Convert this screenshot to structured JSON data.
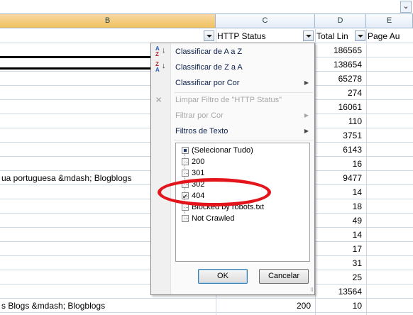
{
  "window": {
    "expand_label": "⌄"
  },
  "columns": {
    "b": "B",
    "c": "C",
    "d": "D",
    "e": "E"
  },
  "headers": {
    "c": "HTTP Status",
    "d": "Total Lin",
    "e": "Page Au"
  },
  "rows": [
    {
      "b": "",
      "c": "",
      "d": "186565"
    },
    {
      "b": "",
      "c": "",
      "d": "138654"
    },
    {
      "b": "",
      "c": "",
      "d": "65278"
    },
    {
      "b": "",
      "c": "",
      "d": "274"
    },
    {
      "b": "",
      "c": "",
      "d": "16061"
    },
    {
      "b": "",
      "c": "",
      "d": "110"
    },
    {
      "b": "",
      "c": "",
      "d": "3751"
    },
    {
      "b": "",
      "c": "",
      "d": "6143"
    },
    {
      "b": "",
      "c": "",
      "d": "16"
    },
    {
      "b": "ua portuguesa &mdash; Blogblogs",
      "c": "",
      "d": "9477"
    },
    {
      "b": "",
      "c": "",
      "d": "14"
    },
    {
      "b": "",
      "c": "",
      "d": "18"
    },
    {
      "b": "",
      "c": "",
      "d": "49"
    },
    {
      "b": "",
      "c": "",
      "d": "14"
    },
    {
      "b": "",
      "c": "",
      "d": "17"
    },
    {
      "b": "",
      "c": "",
      "d": "31"
    },
    {
      "b": "",
      "c": "",
      "d": "25"
    },
    {
      "b": "",
      "c": "",
      "d": "13564"
    },
    {
      "b": "s Blogs &mdash; Blogblogs",
      "c": "200",
      "d": "10"
    }
  ],
  "menu": {
    "sort_az": "Classificar de A a Z",
    "sort_za": "Classificar de Z a A",
    "sort_color": "Classificar por Cor",
    "clear_filter": "Limpar Filtro de \"HTTP Status\"",
    "filter_color": "Filtrar por Cor",
    "text_filters": "Filtros de Texto",
    "icon_sort_az_top": "A",
    "icon_sort_az_bottom": "Z",
    "icon_sort_za_top": "Z",
    "icon_sort_za_bottom": "A",
    "list": [
      {
        "label": "(Selecionar Tudo)",
        "state": "mixed"
      },
      {
        "label": "200",
        "state": "unchecked"
      },
      {
        "label": "301",
        "state": "unchecked"
      },
      {
        "label": "302",
        "state": "unchecked"
      },
      {
        "label": "404",
        "state": "checked"
      },
      {
        "label": "Blocked by robots.txt",
        "state": "unchecked"
      },
      {
        "label": "Not Crawled",
        "state": "unchecked"
      }
    ],
    "ok": "OK",
    "cancel": "Cancelar"
  },
  "colors": {
    "highlight_ring": "#e4141b",
    "header_selected": "#f1c15f",
    "menu_text": "#0a1e4a"
  }
}
